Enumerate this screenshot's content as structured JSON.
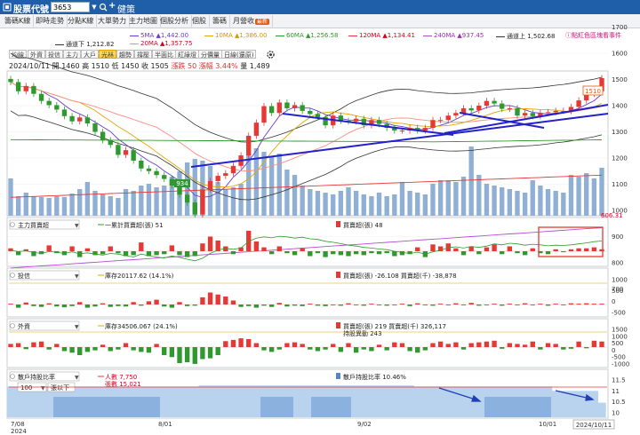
{
  "header": {
    "title": "股票代號",
    "stock_code": "3653",
    "stock_name": "健策"
  },
  "tabs": [
    {
      "label": "籌碼K線",
      "active": true
    },
    {
      "label": "即時走勢"
    },
    {
      "label": "分點K線"
    },
    {
      "label": "大單勢力"
    },
    {
      "label": "主力地圖"
    },
    {
      "label": "個股分析"
    },
    {
      "label": "個股"
    },
    {
      "label": "籌碼"
    },
    {
      "label": "月營收",
      "badge": "最新"
    }
  ],
  "ma_legend": {
    "ma5": "5MA ▲1,442.00",
    "ma10": "10MA ▲1,386.00",
    "ma60": "60MA ▲1,256.58",
    "ma120": "120MA ▲1,134.41",
    "ma240": "240MA ▲937.45",
    "upper": "通道上 1,502.68",
    "lower": "通道下 1,212.82",
    "ma20": "20MA ▲1,357.75"
  },
  "hint": "ⓘ點紅色區塊看事件",
  "toolbar": {
    "items": [
      "均線",
      "外資",
      "投信",
      "主力",
      "大戶",
      "光林",
      "趨勢",
      "撐壓",
      "半面比",
      "紅綠燈",
      "分價量",
      "日線(還原)"
    ],
    "active": "光林"
  },
  "ohlc": {
    "date": "2024/10/11",
    "text": "開 1460  高 1510  低 1450  收 1505",
    "change": "漲跌 50  漲幅 3.44%",
    "volume": "量 1,489"
  },
  "price_axis": [
    "1700",
    "1600",
    "1500",
    "1400",
    "1300",
    "1200",
    "1100",
    "1000",
    "900",
    "800",
    "700"
  ],
  "price_labels": {
    "last": "1510",
    "low": "934",
    "volume_max": "606.31"
  },
  "panels": {
    "main_force": {
      "select": "主力買賣超",
      "legend_line": "一累計買賣超(張) 51",
      "legend_bar": "買賣超(張) 48"
    },
    "trust": {
      "select": "投信",
      "legend_line": "庫存20117.62 (14.1%)",
      "legend_bar": "買賣超(張) -26.108  買賣超(千) -38,878",
      "axis": [
        "1000",
        "500",
        "0",
        "-500"
      ]
    },
    "foreign": {
      "select": "外資",
      "legend_line": "庫存34506.067 (24.1%)",
      "legend_bar": "買賣超(張) 219  買賣超(千) 326,117",
      "legend_extra": "持股異動 243",
      "axis": [
        "1500",
        "1000",
        "500",
        "0",
        "-500",
        "-1000"
      ]
    },
    "holders": {
      "select": "散戶持股比率",
      "sub_select": "100",
      "sub_label": "張以下",
      "legend_people": "人數 7,750",
      "legend_shares": "張數 15,021",
      "legend_ratio": "散戶持股比率 10.46%",
      "axis": [
        "11.5",
        "11",
        "10.5",
        "10"
      ]
    }
  },
  "x_axis": {
    "labels": [
      "7/08",
      "8/01",
      "9/02",
      "10/01"
    ],
    "year": "2024",
    "current": "2024/10/11"
  },
  "colors": {
    "up": "#e53935",
    "down": "#2e9a2e",
    "accent": "#1f5ea8",
    "volume": "#8fb0d4"
  },
  "chart_data": {
    "type": "candlestick",
    "closes": [
      1490,
      1455,
      1475,
      1445,
      1418,
      1402,
      1385,
      1360,
      1340,
      1355,
      1332,
      1300,
      1268,
      1250,
      1212,
      1230,
      1190,
      1160,
      1150,
      1135,
      1120,
      1095,
      1060,
      1030,
      985,
      1080,
      1112,
      1132,
      1142,
      1170,
      1210,
      1285,
      1335,
      1398,
      1372,
      1412,
      1390,
      1402,
      1380,
      1368,
      1356,
      1325,
      1362,
      1342,
      1340,
      1350,
      1325,
      1345,
      1330,
      1315,
      1305,
      1305,
      1315,
      1305,
      1315,
      1345,
      1345,
      1362,
      1372,
      1390,
      1382,
      1400,
      1418,
      1408,
      1388,
      1390,
      1362,
      1372,
      1360,
      1372,
      1375,
      1380,
      1380,
      1395,
      1420,
      1445,
      1455,
      1505
    ],
    "volumes": [
      210,
      110,
      130,
      110,
      105,
      100,
      110,
      105,
      125,
      150,
      190,
      140,
      120,
      110,
      100,
      150,
      140,
      170,
      180,
      160,
      170,
      220,
      250,
      300,
      320,
      310,
      280,
      190,
      150,
      160,
      180,
      350,
      380,
      360,
      330,
      350,
      260,
      230,
      170,
      150,
      140,
      130,
      120,
      140,
      160,
      140,
      120,
      110,
      130,
      110,
      120,
      190,
      140,
      130,
      120,
      180,
      200,
      200,
      190,
      220,
      390,
      230,
      180,
      170,
      160,
      150,
      140,
      130,
      200,
      170,
      150,
      140,
      130,
      230,
      220,
      240,
      210,
      270
    ],
    "main_force": [
      6,
      -8,
      4,
      -10,
      -6,
      12,
      -4,
      -8,
      10,
      -12,
      6,
      -8,
      -6,
      10,
      -4,
      -10,
      -8,
      18,
      -10,
      -8,
      -6,
      12,
      -8,
      -12,
      -10,
      16,
      30,
      22,
      10,
      -6,
      8,
      42,
      20,
      8,
      -6,
      10,
      -4,
      -8,
      6,
      -10,
      -4,
      -12,
      -6,
      -8,
      -10,
      -6,
      -8,
      -4,
      -6,
      -4,
      -10,
      -8,
      -6,
      8,
      -12,
      14,
      10,
      16,
      6,
      -8,
      10,
      -6,
      8,
      14,
      -6,
      10,
      -4,
      -8,
      6,
      -4,
      -6,
      4,
      -2,
      4,
      6,
      6,
      8,
      4
    ],
    "trust": [
      2,
      -8,
      5,
      -4,
      -6,
      3,
      -5,
      -7,
      -4,
      6,
      -8,
      -5,
      3,
      -6,
      -4,
      -5,
      6,
      -3,
      8,
      12,
      -5,
      -8,
      6,
      -4,
      -3,
      18,
      30,
      25,
      20,
      10,
      -6,
      -4,
      -8,
      -3,
      -6,
      4,
      -5,
      -3,
      -4,
      2,
      -3,
      -4,
      -2,
      -3,
      3,
      -2,
      -3,
      2,
      -2,
      -3,
      -2,
      2,
      -4,
      3,
      -2,
      -3,
      2,
      -2,
      3,
      -2,
      4,
      -3,
      -2,
      2,
      -3,
      2,
      -2,
      3,
      -2,
      2,
      -3,
      2,
      -2,
      3,
      2,
      3,
      2,
      2
    ],
    "foreign": [
      8,
      10,
      -5,
      12,
      14,
      -6,
      8,
      -10,
      -14,
      -20,
      -12,
      -8,
      6,
      -10,
      -6,
      10,
      -8,
      -12,
      -14,
      8,
      -20,
      -25,
      -40,
      -38,
      -42,
      -30,
      -28,
      -20,
      15,
      18,
      22,
      20,
      10,
      -8,
      -12,
      -6,
      10,
      12,
      8,
      -6,
      -10,
      -6,
      8,
      -12,
      10,
      -14,
      -6,
      -10,
      6,
      -8,
      12,
      10,
      -10,
      -14,
      -8,
      10,
      14,
      8,
      12,
      -6,
      10,
      12,
      14,
      16,
      -4,
      10,
      8,
      6,
      14,
      -6,
      10,
      8,
      -6,
      -4,
      14,
      -3,
      16,
      14
    ],
    "retail_ratio": [
      11.2,
      11.2,
      11.2,
      11.2,
      11.2,
      11.2,
      11.2,
      11.2,
      11.2,
      11.2,
      11.2,
      11.2,
      11.2,
      11.2,
      11.2,
      11.2,
      11.2,
      11.2,
      11.2,
      11.2,
      11.2,
      11.2,
      11.2,
      11.2,
      11.2,
      11.25,
      11.25,
      11.25,
      11.25,
      11.25,
      11.25,
      11.25,
      11.25,
      11.25,
      11.25,
      11.25,
      11.25,
      11.25,
      11.25,
      11.25,
      11.25,
      11.25,
      11.25,
      11.25,
      11.25,
      11.25,
      11.25,
      11.25,
      11.25,
      11.25,
      11.25,
      11.25,
      11.25,
      11.2,
      11.2,
      11.2,
      11.2,
      11.2,
      11.2,
      11.2,
      11.2,
      11.2,
      11.2,
      11.2,
      11.2,
      11.2,
      11.2,
      11.2,
      11.2,
      11.2,
      11.2,
      11.0,
      11.0,
      11.0,
      11.0,
      11.0,
      11.0,
      10.46
    ]
  }
}
